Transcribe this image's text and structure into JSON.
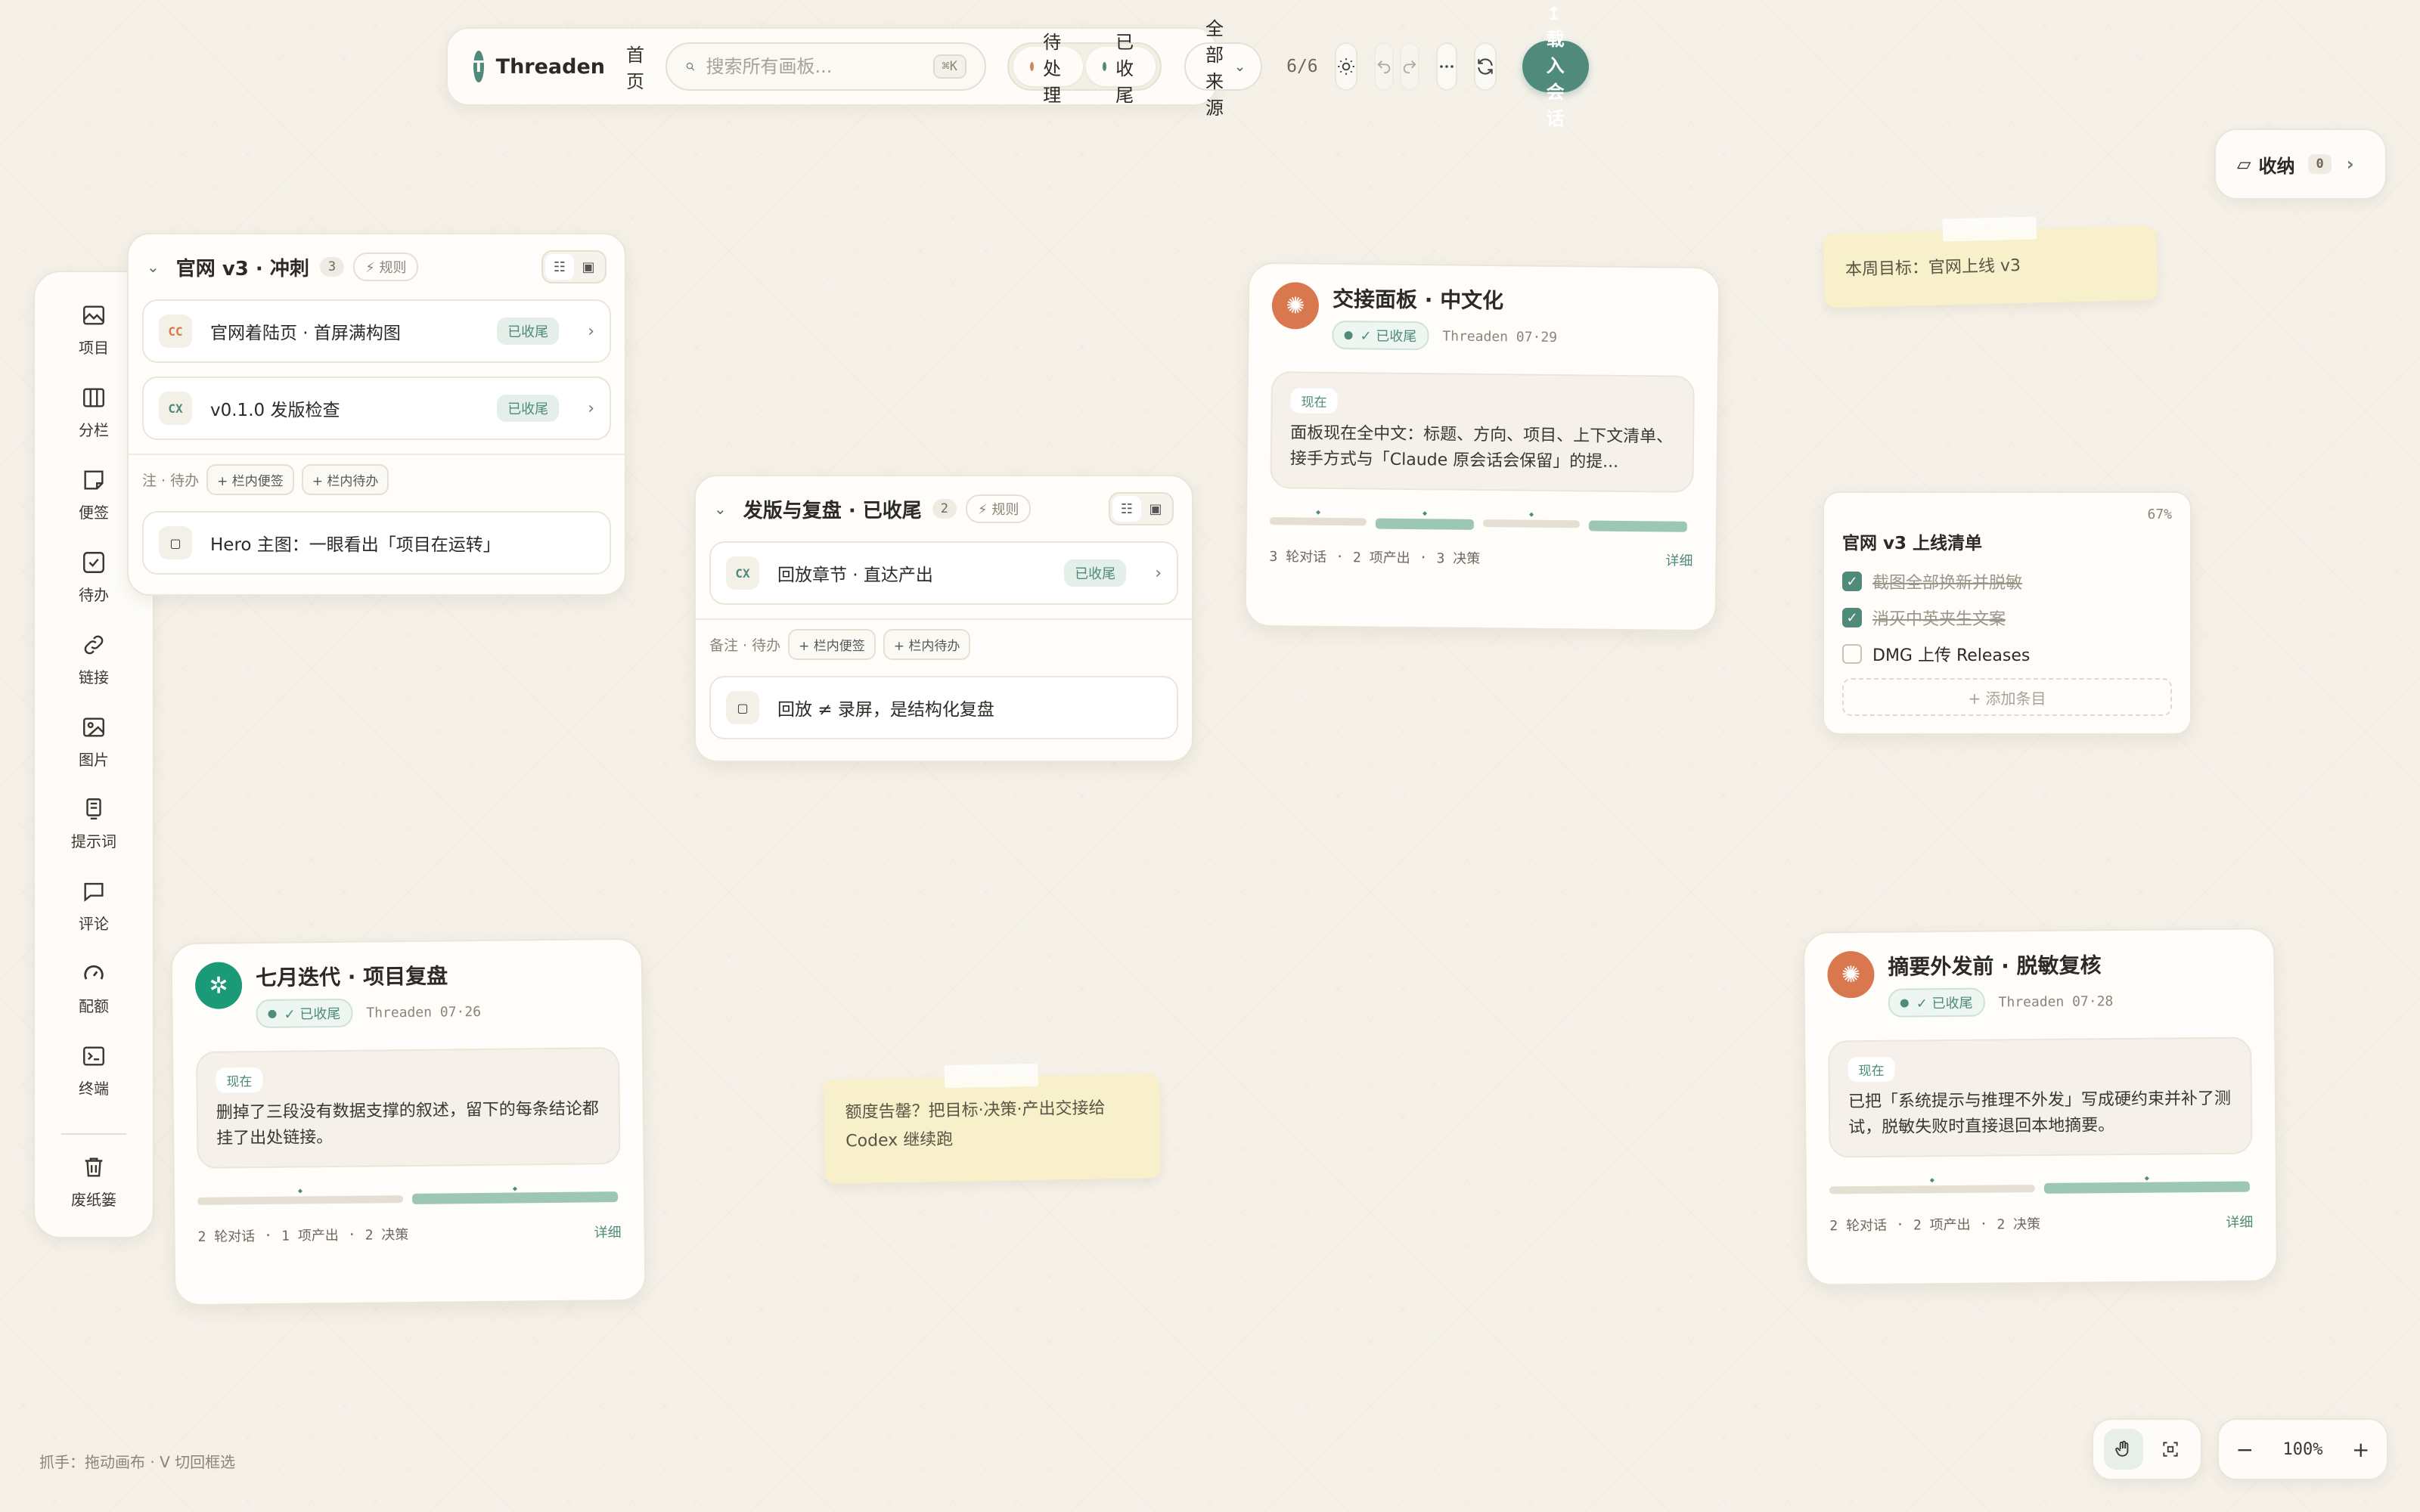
{
  "toolbar": {
    "logo_letter": "T",
    "brand": "Threaden",
    "home": "首页",
    "search_placeholder": "搜索所有画板...",
    "search_shortcut": "⌘K",
    "filter_pending": "待处理",
    "filter_done": "已收尾",
    "source_select": "全部来源",
    "count": "6/6",
    "load_button": "↥ 载入会话"
  },
  "collapse": {
    "label": "收纳",
    "count": "0"
  },
  "sidebar": {
    "items": [
      {
        "label": "项目"
      },
      {
        "label": "分栏"
      },
      {
        "label": "便签"
      },
      {
        "label": "待办"
      },
      {
        "label": "链接"
      },
      {
        "label": "图片"
      },
      {
        "label": "提示词"
      },
      {
        "label": "评论"
      },
      {
        "label": "配额"
      },
      {
        "label": "终端"
      }
    ],
    "trash": "废纸篓"
  },
  "group1": {
    "title": "官网 v3 · 冲刺",
    "count": "3",
    "rule": "⚡ 规则",
    "rows": [
      {
        "tag": "CC",
        "text": "官网着陆页 · 首屏满构图",
        "badge": "已收尾"
      },
      {
        "tag": "CX",
        "text": "v0.1.0 发版检查",
        "badge": "已收尾"
      }
    ],
    "note_label": "注 · 待办",
    "btn_note": "+ 栏内便签",
    "btn_todo": "+ 栏内待办",
    "memo": "Hero 主图：一眼看出「项目在运转」"
  },
  "group2": {
    "title": "发版与复盘 · 已收尾",
    "count": "2",
    "rule": "⚡ 规则",
    "row": {
      "tag": "CX",
      "text": "回放章节 · 直达产出",
      "badge": "已收尾"
    },
    "note_label": "备注 · 待办",
    "btn_note": "+ 栏内便签",
    "btn_todo": "+ 栏内待办",
    "memo": "回放 ≠ 录屏，是结构化复盘"
  },
  "session1": {
    "title": "交接面板 · 中文化",
    "status": "✓ 已收尾",
    "meta": "Threaden 07·29",
    "now_label": "现在",
    "now_text": "面板现在全中文：标题、方向、项目、上下文清单、接手方式与「Claude 原会话会保留」的提...",
    "stats": [
      "3 轮对话",
      "2 项产出",
      "3 决策"
    ],
    "detail": "详细"
  },
  "session2": {
    "title": "七月迭代 · 项目复盘",
    "status": "✓ 已收尾",
    "meta": "Threaden 07·26",
    "now_label": "现在",
    "now_text": "删掉了三段没有数据支撑的叙述，留下的每条结论都挂了出处链接。",
    "stats": [
      "2 轮对话",
      "1 项产出",
      "2 决策"
    ],
    "detail": "详细"
  },
  "session3": {
    "title": "摘要外发前 · 脱敏复核",
    "status": "✓ 已收尾",
    "meta": "Threaden 07·28",
    "now_label": "现在",
    "now_text": "已把「系统提示与推理不外发」写成硬约束并补了测试，脱敏失败时直接退回本地摘要。",
    "stats": [
      "2 轮对话",
      "2 项产出",
      "2 决策"
    ],
    "detail": "详细"
  },
  "sticky1": {
    "text": "本周目标：官网上线 v3"
  },
  "sticky2": {
    "text": "额度告罄？把目标·决策·产出交接给 Codex 继续跑"
  },
  "checklist": {
    "title": "官网 v3 上线清单",
    "progress": "67%",
    "items": [
      {
        "text": "截图全部换新并脱敏",
        "done": true
      },
      {
        "text": "消灭中英夹生文案",
        "done": true
      },
      {
        "text": "DMG 上传 Releases",
        "done": false
      }
    ],
    "add": "+ 添加条目"
  },
  "footer": {
    "hint": "抓手：拖动画布 · V 切回框选",
    "zoom": "100%"
  },
  "colors": {
    "accent": "#4f8a7a",
    "claude": "#d9784f",
    "openai": "#1a9a76",
    "sticky": "#f8efcb"
  }
}
